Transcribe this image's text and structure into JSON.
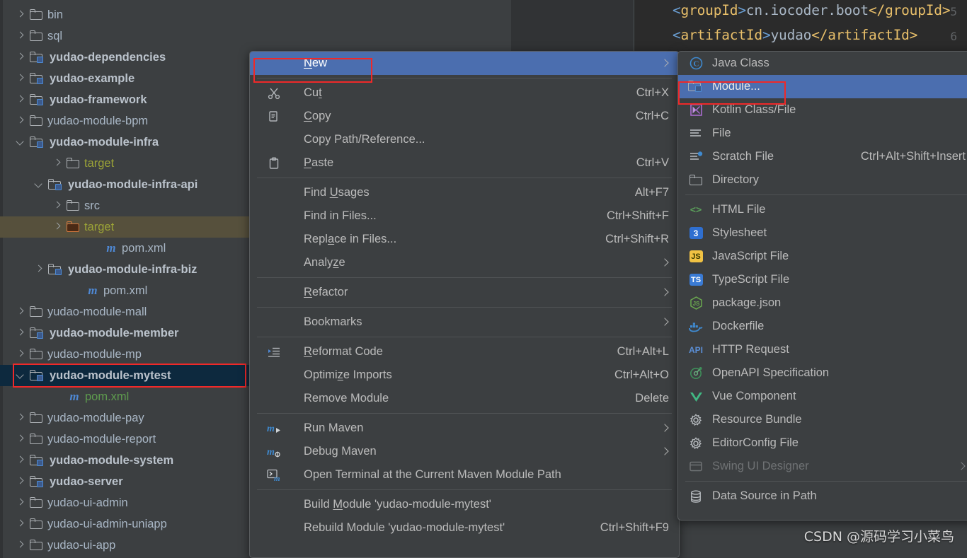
{
  "editor": {
    "lines": [
      {
        "num": "5",
        "open_lt": "<",
        "open_tag": "groupId",
        "open_gt": ">",
        "value": "cn.iocoder.boot",
        "close": "</groupId>"
      },
      {
        "num": "6",
        "open_lt": "<",
        "open_tag": "artifactId",
        "open_gt": ">",
        "value": "yudao",
        "close": "</artifactId>"
      }
    ]
  },
  "tree": {
    "items": [
      {
        "label": "bin",
        "arrow": "right",
        "icon": "folder",
        "indent": 44,
        "style": ""
      },
      {
        "label": "sql",
        "arrow": "right",
        "icon": "folder",
        "indent": 44,
        "style": ""
      },
      {
        "label": "yudao-dependencies",
        "arrow": "right",
        "icon": "module",
        "indent": 44,
        "style": "bold"
      },
      {
        "label": "yudao-example",
        "arrow": "right",
        "icon": "module",
        "indent": 44,
        "style": "bold"
      },
      {
        "label": "yudao-framework",
        "arrow": "right",
        "icon": "module",
        "indent": 44,
        "style": "bold"
      },
      {
        "label": "yudao-module-bpm",
        "arrow": "right",
        "icon": "folder",
        "indent": 44,
        "style": ""
      },
      {
        "label": "yudao-module-infra",
        "arrow": "down",
        "icon": "module",
        "indent": 44,
        "style": "bold"
      },
      {
        "label": "target",
        "arrow": "right",
        "icon": "folder",
        "indent": 96,
        "style": "olive"
      },
      {
        "label": "yudao-module-infra-api",
        "arrow": "down",
        "icon": "module",
        "indent": 70,
        "style": "bold"
      },
      {
        "label": "src",
        "arrow": "right",
        "icon": "folder",
        "indent": 96,
        "style": ""
      },
      {
        "label": "target",
        "arrow": "right",
        "icon": "folder-orange",
        "indent": 96,
        "style": "olive",
        "row": "hl-target"
      },
      {
        "label": "pom.xml",
        "arrow": "none",
        "icon": "maven-m",
        "indent": 150,
        "style": ""
      },
      {
        "label": "yudao-module-infra-biz",
        "arrow": "right",
        "icon": "module",
        "indent": 70,
        "style": "bold"
      },
      {
        "label": "pom.xml",
        "arrow": "none",
        "icon": "maven-m",
        "indent": 124,
        "style": ""
      },
      {
        "label": "yudao-module-mall",
        "arrow": "right",
        "icon": "folder",
        "indent": 44,
        "style": ""
      },
      {
        "label": "yudao-module-member",
        "arrow": "right",
        "icon": "module",
        "indent": 44,
        "style": "bold"
      },
      {
        "label": "yudao-module-mp",
        "arrow": "right",
        "icon": "folder",
        "indent": 44,
        "style": ""
      },
      {
        "label": "yudao-module-mytest",
        "arrow": "down",
        "icon": "module",
        "indent": 44,
        "style": "bold",
        "row": "hl-sel"
      },
      {
        "label": "pom.xml",
        "arrow": "none",
        "icon": "maven-m",
        "indent": 98,
        "style": "green"
      },
      {
        "label": "yudao-module-pay",
        "arrow": "right",
        "icon": "folder",
        "indent": 44,
        "style": ""
      },
      {
        "label": "yudao-module-report",
        "arrow": "right",
        "icon": "folder",
        "indent": 44,
        "style": ""
      },
      {
        "label": "yudao-module-system",
        "arrow": "right",
        "icon": "module",
        "indent": 44,
        "style": "bold"
      },
      {
        "label": "yudao-server",
        "arrow": "right",
        "icon": "module",
        "indent": 44,
        "style": "bold"
      },
      {
        "label": "yudao-ui-admin",
        "arrow": "right",
        "icon": "folder",
        "indent": 44,
        "style": ""
      },
      {
        "label": "yudao-ui-admin-uniapp",
        "arrow": "right",
        "icon": "folder",
        "indent": 44,
        "style": ""
      },
      {
        "label": "yudao-ui-app",
        "arrow": "right",
        "icon": "folder",
        "indent": 44,
        "style": ""
      }
    ]
  },
  "context_menu": {
    "items": [
      {
        "kind": "item",
        "label": "New",
        "mnemonic": "N",
        "icon": "none",
        "submenu": true,
        "selected": true
      },
      {
        "kind": "sep"
      },
      {
        "kind": "item",
        "label": "Cut",
        "mnemonic": "t",
        "icon": "scissors",
        "shortcut": "Ctrl+X"
      },
      {
        "kind": "item",
        "label": "Copy",
        "mnemonic": "C",
        "icon": "copy",
        "shortcut": "Ctrl+C"
      },
      {
        "kind": "item",
        "label": "Copy Path/Reference...",
        "mnemonic": "",
        "icon": "none",
        "shortcut": ""
      },
      {
        "kind": "item",
        "label": "Paste",
        "mnemonic": "P",
        "icon": "clipboard",
        "shortcut": "Ctrl+V"
      },
      {
        "kind": "sep"
      },
      {
        "kind": "item",
        "label": "Find Usages",
        "mnemonic": "U",
        "icon": "none",
        "shortcut": "Alt+F7"
      },
      {
        "kind": "item",
        "label": "Find in Files...",
        "mnemonic": "",
        "icon": "none",
        "shortcut": "Ctrl+Shift+F"
      },
      {
        "kind": "item",
        "label": "Replace in Files...",
        "mnemonic": "a",
        "icon": "none",
        "shortcut": "Ctrl+Shift+R"
      },
      {
        "kind": "item",
        "label": "Analyze",
        "mnemonic": "z",
        "icon": "none",
        "submenu": true
      },
      {
        "kind": "sep"
      },
      {
        "kind": "item",
        "label": "Refactor",
        "mnemonic": "R",
        "icon": "none",
        "submenu": true
      },
      {
        "kind": "sep"
      },
      {
        "kind": "item",
        "label": "Bookmarks",
        "mnemonic": "",
        "icon": "none",
        "submenu": true
      },
      {
        "kind": "sep"
      },
      {
        "kind": "item",
        "label": "Reformat Code",
        "mnemonic": "R",
        "icon": "reformat",
        "shortcut": "Ctrl+Alt+L"
      },
      {
        "kind": "item",
        "label": "Optimize Imports",
        "mnemonic": "z",
        "icon": "none",
        "shortcut": "Ctrl+Alt+O"
      },
      {
        "kind": "item",
        "label": "Remove Module",
        "mnemonic": "",
        "icon": "none",
        "shortcut": "Delete"
      },
      {
        "kind": "sep"
      },
      {
        "kind": "item",
        "label": "Run Maven",
        "mnemonic": "",
        "icon": "maven-run",
        "submenu": true
      },
      {
        "kind": "item",
        "label": "Debug Maven",
        "mnemonic": "",
        "icon": "maven-debug",
        "submenu": true
      },
      {
        "kind": "item",
        "label": "Open Terminal at the Current Maven Module Path",
        "mnemonic": "",
        "icon": "terminal-m",
        "shortcut": ""
      },
      {
        "kind": "sep"
      },
      {
        "kind": "item",
        "label": "Build Module 'yudao-module-mytest'",
        "mnemonic": "M",
        "icon": "none",
        "shortcut": ""
      },
      {
        "kind": "item",
        "label": "Rebuild Module 'yudao-module-mytest'",
        "mnemonic": "",
        "icon": "none",
        "shortcut": "Ctrl+Shift+F9"
      }
    ]
  },
  "new_submenu": {
    "items": [
      {
        "kind": "item",
        "label": "Java Class",
        "icon": "java-class"
      },
      {
        "kind": "item",
        "label": "Module...",
        "icon": "module-folder",
        "selected": true
      },
      {
        "kind": "item",
        "label": "Kotlin Class/File",
        "icon": "kotlin"
      },
      {
        "kind": "item",
        "label": "File",
        "icon": "file-lines"
      },
      {
        "kind": "item",
        "label": "Scratch File",
        "icon": "scratch",
        "shortcut": "Ctrl+Alt+Shift+Insert"
      },
      {
        "kind": "item",
        "label": "Directory",
        "icon": "directory"
      },
      {
        "kind": "sep"
      },
      {
        "kind": "item",
        "label": "HTML File",
        "icon": "html"
      },
      {
        "kind": "item",
        "label": "Stylesheet",
        "icon": "css"
      },
      {
        "kind": "item",
        "label": "JavaScript File",
        "icon": "js"
      },
      {
        "kind": "item",
        "label": "TypeScript File",
        "icon": "ts"
      },
      {
        "kind": "item",
        "label": "package.json",
        "icon": "nodejs"
      },
      {
        "kind": "item",
        "label": "Dockerfile",
        "icon": "docker"
      },
      {
        "kind": "item",
        "label": "HTTP Request",
        "icon": "api"
      },
      {
        "kind": "item",
        "label": "OpenAPI Specification",
        "icon": "openapi"
      },
      {
        "kind": "item",
        "label": "Vue Component",
        "icon": "vue"
      },
      {
        "kind": "item",
        "label": "Resource Bundle",
        "icon": "gear"
      },
      {
        "kind": "item",
        "label": "EditorConfig File",
        "icon": "gear"
      },
      {
        "kind": "item",
        "label": "Swing UI Designer",
        "icon": "swing",
        "disabled": true,
        "submenu": true
      },
      {
        "kind": "sep"
      },
      {
        "kind": "item",
        "label": "Data Source in Path",
        "icon": "database"
      }
    ]
  },
  "watermark": {
    "text": "CSDN @源码学习小菜鸟"
  },
  "colors": {
    "menu_bg": "#3c3f41",
    "selection_blue": "#4b6eaf",
    "tree_selection": "#0d293e",
    "highlight_red": "#ef2929",
    "target_row_bg": "#56503c",
    "editor_bg": "#2b2b2b",
    "text": "#bbbbbb"
  }
}
